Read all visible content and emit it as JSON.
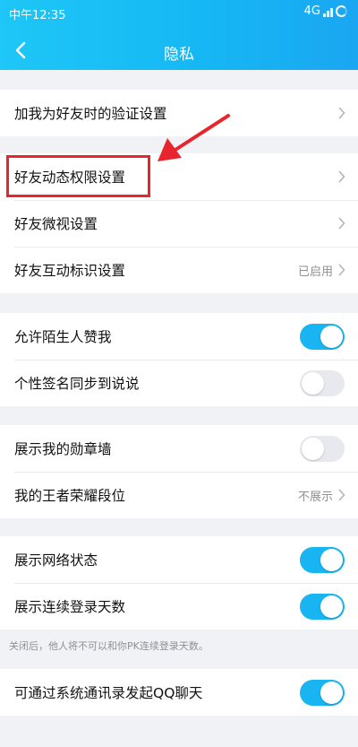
{
  "status_bar": {
    "time": "中午12:35",
    "network": "4G"
  },
  "header": {
    "title": "隐私",
    "back_icon": "chevron-left-icon"
  },
  "groups": [
    {
      "items": [
        {
          "label": "加我为好友时的验证设置",
          "type": "link"
        }
      ]
    },
    {
      "items": [
        {
          "label": "好友动态权限设置",
          "type": "link"
        },
        {
          "label": "好友微视设置",
          "type": "link"
        },
        {
          "label": "好友互动标识设置",
          "type": "link",
          "value": "已启用"
        }
      ]
    },
    {
      "items": [
        {
          "label": "允许陌生人赞我",
          "type": "toggle",
          "on": true
        },
        {
          "label": "个性签名同步到说说",
          "type": "toggle",
          "on": false
        }
      ]
    },
    {
      "items": [
        {
          "label": "展示我的勋章墙",
          "type": "toggle",
          "on": false
        },
        {
          "label": "我的王者荣耀段位",
          "type": "link",
          "value": "不展示"
        }
      ]
    },
    {
      "items": [
        {
          "label": "展示网络状态",
          "type": "toggle",
          "on": true
        },
        {
          "label": "展示连续登录天数",
          "type": "toggle",
          "on": true
        }
      ]
    },
    {
      "items": [
        {
          "label": "可通过系统通讯录发起QQ聊天",
          "type": "toggle",
          "on": true
        }
      ]
    }
  ],
  "note": "关闭后，他人将不可以和你PK连续登录天数。",
  "colors": {
    "accent": "#19b5f2",
    "annotation": "#e8242c"
  }
}
